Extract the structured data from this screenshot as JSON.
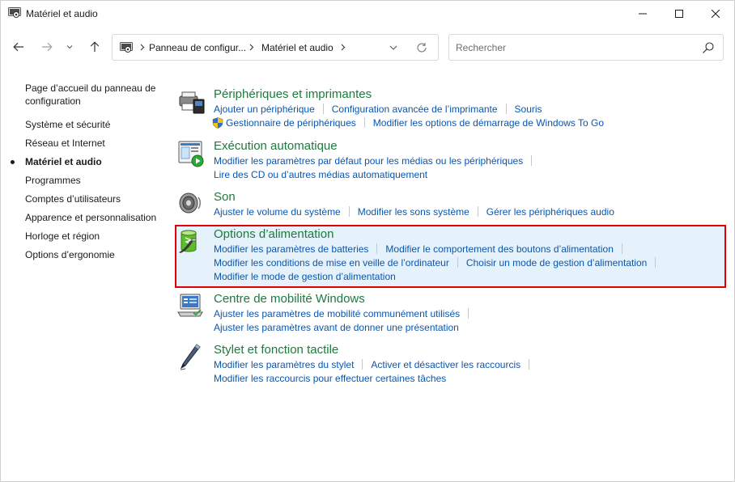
{
  "window": {
    "title": "Matériel et audio"
  },
  "navigation": {
    "breadcrumbs": [
      "Panneau de configur...",
      "Matériel et audio"
    ],
    "search_placeholder": "Rechercher"
  },
  "sidebar": {
    "items": [
      {
        "label": "Page d’accueil du panneau de",
        "label2": "configuration"
      },
      {
        "label": "Système et sécurité"
      },
      {
        "label": "Réseau et Internet"
      },
      {
        "label": "Matériel et audio",
        "current": true
      },
      {
        "label": "Programmes"
      },
      {
        "label": "Comptes d’utilisateurs"
      },
      {
        "label": "Apparence et personnalisation"
      },
      {
        "label": "Horloge et région"
      },
      {
        "label": "Options d’ergonomie"
      }
    ]
  },
  "categories": [
    {
      "title": "Périphériques et imprimantes",
      "icon": "devices-printers-icon",
      "lines": [
        [
          "Ajouter un périphérique",
          "Configuration avancée de l’imprimante",
          "Souris"
        ],
        [
          "Gestionnaire de périphériques",
          "Modifier les options de démarrage de Windows To Go"
        ]
      ]
    },
    {
      "title": "Exécution automatique",
      "icon": "autoplay-icon",
      "lines": [
        [
          "Modifier les paramètres par défaut pour les médias ou les périphériques"
        ],
        [
          "Lire des CD ou d’autres médias automatiquement"
        ]
      ]
    },
    {
      "title": "Son",
      "icon": "speaker-icon",
      "lines": [
        [
          "Ajuster le volume du système",
          "Modifier les sons système",
          "Gérer les périphériques audio"
        ]
      ]
    },
    {
      "title": "Options d’alimentation",
      "icon": "power-options-icon",
      "lines": [
        [
          "Modifier les paramètres de batteries",
          "Modifier le comportement des boutons d’alimentation"
        ],
        [
          "Modifier les conditions de mise en veille de l’ordinateur",
          "Choisir un mode de gestion d’alimentation"
        ],
        [
          "Modifier le mode de gestion d’alimentation"
        ]
      ]
    },
    {
      "title": "Centre de mobilité Windows",
      "icon": "mobility-center-icon",
      "lines": [
        [
          "Ajuster les paramètres de mobilité communément utilisés"
        ],
        [
          "Ajuster les paramètres avant de donner une présentation"
        ]
      ]
    },
    {
      "title": "Stylet et fonction tactile",
      "icon": "pen-touch-icon",
      "lines": [
        [
          "Modifier les paramètres du stylet",
          "Activer et désactiver les raccourcis"
        ],
        [
          "Modifier les raccourcis pour effectuer certaines tâches"
        ]
      ]
    }
  ],
  "colors": {
    "category_title": "#1e7a3c",
    "link": "#0a56b0",
    "highlight_border": "#e00000",
    "highlight_fill": "#e5f1fb"
  }
}
